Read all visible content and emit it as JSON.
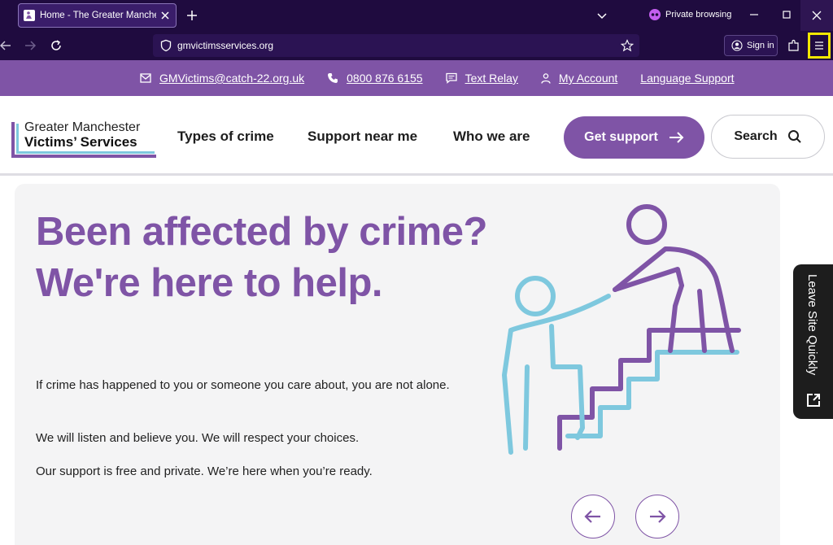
{
  "browser": {
    "tab_title": "Home - The Greater Mancheste",
    "private_label": "Private browsing",
    "url": "gmvictimsservices.org",
    "signin_label": "Sign in"
  },
  "utility_bar": {
    "email": "GMVictims@catch-22.org.uk",
    "phone": "0800 876 6155",
    "text_relay": "Text Relay",
    "account": "My Account",
    "language": "Language Support"
  },
  "logo": {
    "line1": "Greater Manchester",
    "line2": "Victims’ Services"
  },
  "nav": {
    "types": "Types of crime",
    "support": "Support near me",
    "who": "Who we are",
    "get_support": "Get support",
    "search": "Search"
  },
  "hero": {
    "title": "Been affected by crime? We're here to help.",
    "p1": "If crime has happened to you or someone you care about, you are not alone.",
    "p2": "We will listen and believe you. We will respect your choices.",
    "p3": "Our support is free and private. We’re here when you’re ready."
  },
  "leave_site": "Leave Site Quickly",
  "colors": {
    "brand_purple": "#7f54a6",
    "accent_blue": "#7ec8de",
    "browser_bg": "#1f0b3f",
    "highlight": "#f2e700"
  }
}
